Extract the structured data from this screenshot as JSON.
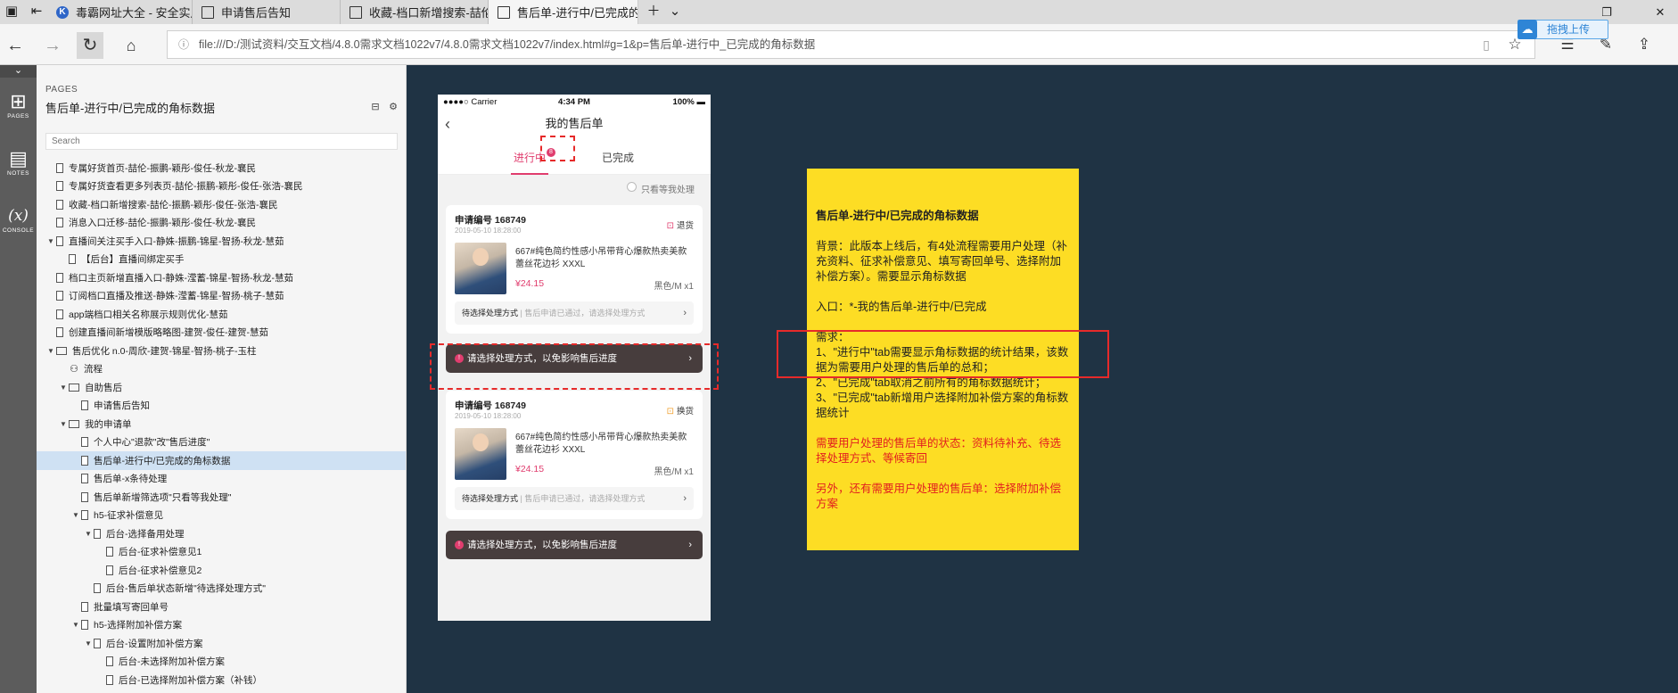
{
  "browser": {
    "tabs": [
      {
        "label": "毒霸网址大全 - 安全实用的",
        "icon": "k-icon"
      },
      {
        "label": "申请售后告知",
        "icon": "page-icon"
      },
      {
        "label": "收藏-档口新增搜索-喆伦-颖",
        "icon": "page-icon"
      },
      {
        "label": "售后单-进行中/已完成的",
        "icon": "page-icon",
        "active": true
      }
    ],
    "url": "file:///D:/测试资料/交互文档/4.8.0需求文档1022v7/4.8.0需求文档1022v7/index.html#g=1&p=售后单-进行中_已完成的角标数据",
    "upload_label": "拖拽上传"
  },
  "rail": {
    "collapse": "⌄",
    "items": [
      {
        "icon": "sitemap-icon",
        "label": "PAGES"
      },
      {
        "icon": "notes-icon",
        "label": "NOTES"
      },
      {
        "icon": "variable-icon",
        "label": "CONSOLE"
      }
    ]
  },
  "panel": {
    "head": "PAGES",
    "title": "售后单-进行中/已完成的角标数据",
    "search_placeholder": "Search",
    "tree": [
      {
        "label": "专属好货首页-喆伦-振鹏-颖彤-俊任-秋龙-襄民",
        "indent": 0,
        "type": "page"
      },
      {
        "label": "专属好货查看更多列表页-喆伦-振鹏-颖彤-俊任-张浩-襄民",
        "indent": 0,
        "type": "page"
      },
      {
        "label": "收藏-档口新增搜索-喆伦-振鹏-颖彤-俊任-张浩-襄民",
        "indent": 0,
        "type": "page"
      },
      {
        "label": "消息入口迁移-喆伦-振鹏-颖彤-俊任-秋龙-襄民",
        "indent": 0,
        "type": "page"
      },
      {
        "label": "直播间关注买手入口-静姝-振鹏-锦星-智扬-秋龙-慧茹",
        "indent": 0,
        "type": "page",
        "caret": "▼"
      },
      {
        "label": "【后台】直播间绑定买手",
        "indent": 1,
        "type": "page"
      },
      {
        "label": "档口主页新增直播入口-静姝-滢蓄-锦星-智扬-秋龙-慧茹",
        "indent": 0,
        "type": "page"
      },
      {
        "label": "订阅档口直播及推送-静姝-滢蓄-锦星-智扬-桃子-慧茹",
        "indent": 0,
        "type": "page"
      },
      {
        "label": "app端档口相关名称展示规则优化-慧茹",
        "indent": 0,
        "type": "page"
      },
      {
        "label": "创建直播间新增模版略略图-建贺-俊任-建贺-慧茹",
        "indent": 0,
        "type": "page"
      },
      {
        "label": "售后优化 n.0-周欣-建贺-锦星-智扬-桃子-玉柱",
        "indent": 0,
        "type": "folder",
        "caret": "▼"
      },
      {
        "label": "流程",
        "indent": 1,
        "type": "flow"
      },
      {
        "label": "自助售后",
        "indent": 1,
        "type": "folder",
        "caret": "▼"
      },
      {
        "label": "申请售后告知",
        "indent": 2,
        "type": "page"
      },
      {
        "label": "我的申请单",
        "indent": 1,
        "type": "folder",
        "caret": "▼"
      },
      {
        "label": "个人中心\"退款\"改\"售后进度\"",
        "indent": 2,
        "type": "page"
      },
      {
        "label": "售后单-进行中/已完成的角标数据",
        "indent": 2,
        "type": "page",
        "selected": true
      },
      {
        "label": "售后单-x条待处理",
        "indent": 2,
        "type": "page"
      },
      {
        "label": "售后单新增筛选项\"只看等我处理\"",
        "indent": 2,
        "type": "page"
      },
      {
        "label": "h5-征求补偿意见",
        "indent": 2,
        "type": "page",
        "caret": "▼"
      },
      {
        "label": "后台-选择备用处理",
        "indent": 3,
        "type": "page",
        "caret": "▼"
      },
      {
        "label": "后台-征求补偿意见1",
        "indent": 4,
        "type": "page"
      },
      {
        "label": "后台-征求补偿意见2",
        "indent": 4,
        "type": "page"
      },
      {
        "label": "后台-售后单状态新增\"待选择处理方式\"",
        "indent": 3,
        "type": "page"
      },
      {
        "label": "批量填写寄回单号",
        "indent": 2,
        "type": "page"
      },
      {
        "label": "h5-选择附加补偿方案",
        "indent": 2,
        "type": "page",
        "caret": "▼"
      },
      {
        "label": "后台-设置附加补偿方案",
        "indent": 3,
        "type": "page",
        "caret": "▼"
      },
      {
        "label": "后台-未选择附加补偿方案",
        "indent": 4,
        "type": "page"
      },
      {
        "label": "后台-已选择附加补偿方案（补钱）",
        "indent": 4,
        "type": "page"
      }
    ]
  },
  "phone": {
    "status": {
      "carrier": "●●●●○ Carrier",
      "time": "4:34 PM",
      "battery": "100%"
    },
    "nav_title": "我的售后单",
    "tab_active": "进行中",
    "tab_badge": "8",
    "tab_other": "已完成",
    "filter_label": "只看等我处理",
    "cards": [
      {
        "no": "申请编号 168749",
        "date": "2019-05-10 18:28:00",
        "type_icon": "refund-icon",
        "type": "退货",
        "name": "667#纯色简约性感小吊带背心爆款热卖美款蕾丝花边衫 XXXL",
        "price": "¥24.15",
        "spec": "黑色/M x1",
        "opt_bold": "待选择处理方式",
        "opt_gray": "| 售后申请已通过，请选择处理方式"
      },
      {
        "no": "申请编号 168749",
        "date": "2019-05-10 18:28:00",
        "type_icon": "exchange-icon",
        "type": "换货",
        "name": "667#纯色简约性感小吊带背心爆款热卖美款蕾丝花边衫 XXXL",
        "price": "¥24.15",
        "spec": "黑色/M x1",
        "opt_bold": "待选择处理方式",
        "opt_gray": "| 售后申请已通过，请选择处理方式"
      }
    ],
    "warn_text": "请选择处理方式，以免影响售后进度"
  },
  "note": {
    "title": "售后单-进行中/已完成的角标数据",
    "background": "背景：此版本上线后，有4处流程需要用户处理（补充资料、征求补偿意见、填写寄回单号、选择附加补偿方案）。需要显示角标数据",
    "entry": "入口：*-我的售后单-进行中/已完成",
    "req_head": "需求：",
    "req_1": "1、\"进行中\"tab需要显示角标数据的统计结果，该数据为需要用户处理的售后单的总和；",
    "req_2": "2、\"已完成\"tab取消之前所有的角标数据统计；",
    "req_3": "3、\"已完成\"tab新增用户选择附加补偿方案的角标数据统计",
    "red_1": "需要用户处理的售后单的状态：资料待补充、待选择处理方式、等候寄回",
    "red_2": "另外，还有需要用户处理的售后单：选择附加补偿方案"
  },
  "colors": {
    "accent": "#e03d6e",
    "note_bg": "#fddd24",
    "canvas_bg": "#1f3344",
    "annotation_red": "#e62a2a"
  }
}
